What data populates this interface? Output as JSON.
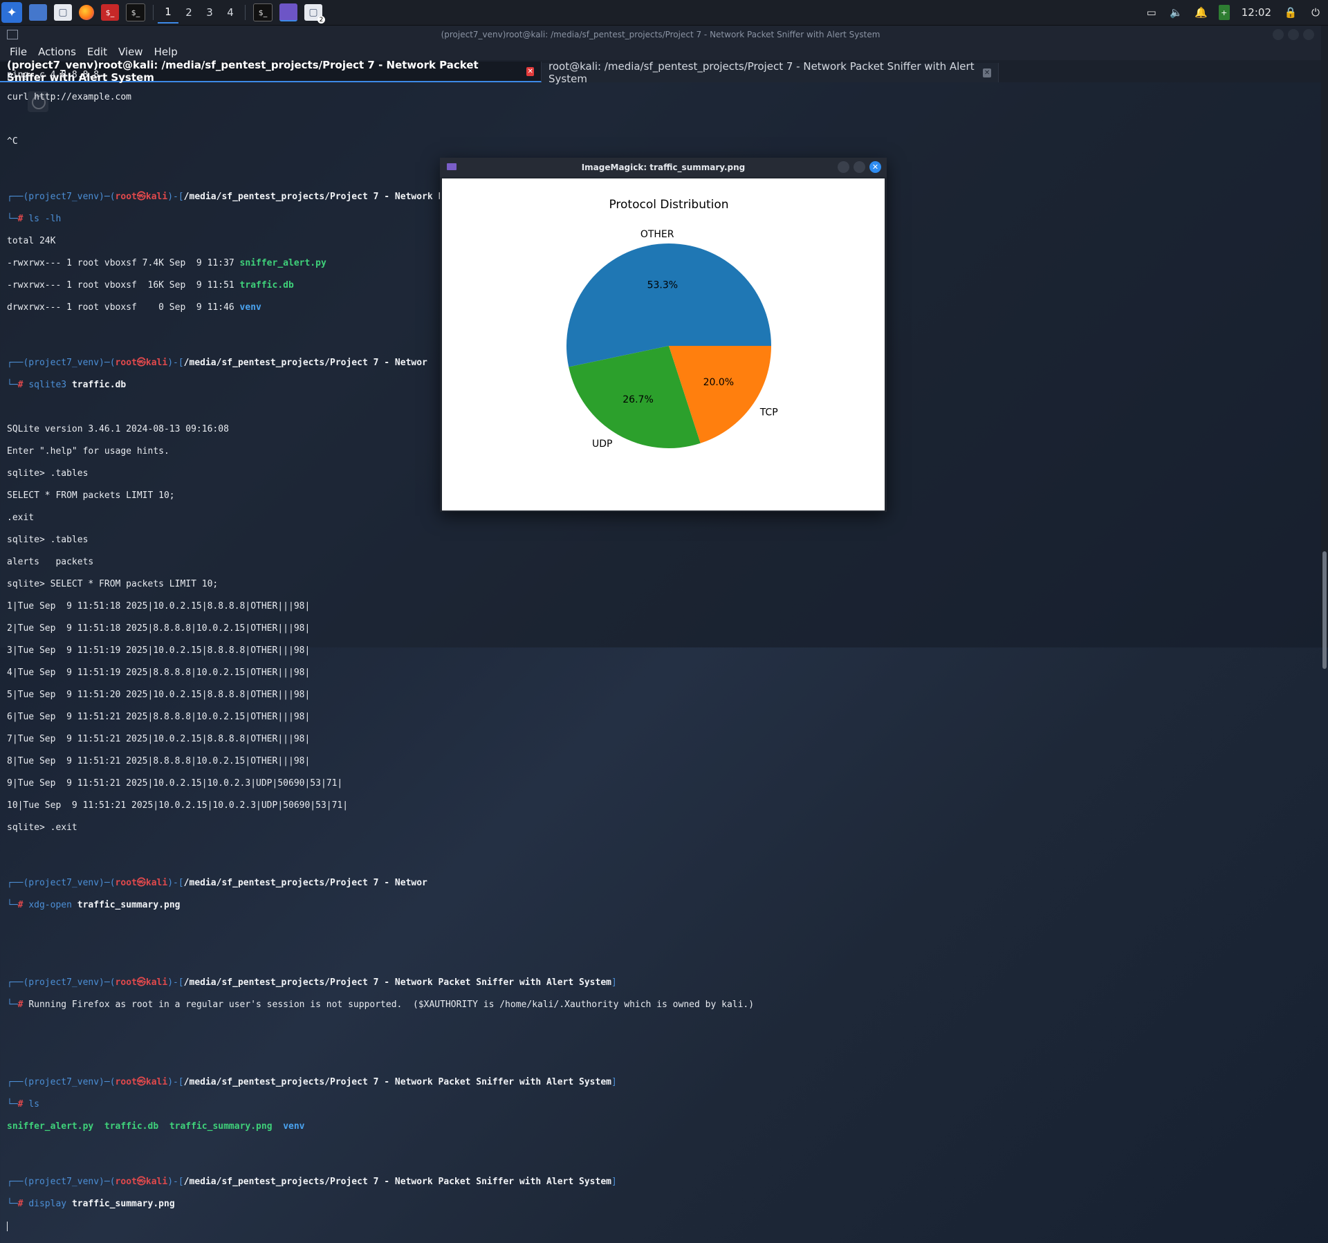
{
  "taskbar": {
    "workspaces": [
      "1",
      "2",
      "3",
      "4"
    ],
    "active_workspace": 0,
    "clock": "12:02",
    "notification_badge": "2"
  },
  "terminal": {
    "window_title": "(project7_venv)root@kali: /media/sf_pentest_projects/Project 7 - Network Packet Sniffer with Alert System",
    "menu": [
      "File",
      "Actions",
      "Edit",
      "View",
      "Help"
    ],
    "tabs": [
      {
        "label": "(project7_venv)root@kali: /media/sf_pentest_projects/Project 7 - Network Packet Sniffer with Alert System",
        "active": true
      },
      {
        "label": "root@kali: /media/sf_pentest_projects/Project 7 - Network Packet Sniffer with Alert System",
        "active": false
      }
    ],
    "prompt": {
      "venv": "(project7_venv)",
      "user": "root",
      "at": "㉿",
      "host": "kali",
      "path_full": "/media/sf_pentest_projects/Project 7 - Network Packet Sniffer with Alert System",
      "path_short": "/media/sf_pentest_projects/Project 7 - Networ"
    },
    "lines": {
      "l1": "ping -c 4 8.8.8.8",
      "l2": "curl http://example.com",
      "l3": "^C",
      "cmd_ls_lh": "ls -lh",
      "total": "total 24K",
      "f1_meta": "-rwxrwx--- 1 root vboxsf 7.4K Sep  9 11:37 ",
      "f1_name": "sniffer_alert.py",
      "f2_meta": "-rwxrwx--- 1 root vboxsf  16K Sep  9 11:51 ",
      "f2_name": "traffic.db",
      "f3_meta": "drwxrwx--- 1 root vboxsf    0 Sep  9 11:46 ",
      "f3_name": "venv",
      "cmd_sqlite": "sqlite3",
      "cmd_sqlite_arg": "traffic.db",
      "sql_version": "SQLite version 3.46.1 2024-08-13 09:16:08",
      "sql_help": "Enter \".help\" for usage hints.",
      "sql_tables1": "sqlite> .tables",
      "sql_select1": "SELECT * FROM packets LIMIT 10;",
      "sql_exit1": ".exit",
      "sql_tables2": "sqlite> .tables",
      "sql_tables_out": "alerts   packets",
      "sql_select2": "sqlite> SELECT * FROM packets LIMIT 10;",
      "rows": [
        "1|Tue Sep  9 11:51:18 2025|10.0.2.15|8.8.8.8|OTHER|||98|",
        "2|Tue Sep  9 11:51:18 2025|8.8.8.8|10.0.2.15|OTHER|||98|",
        "3|Tue Sep  9 11:51:19 2025|10.0.2.15|8.8.8.8|OTHER|||98|",
        "4|Tue Sep  9 11:51:19 2025|8.8.8.8|10.0.2.15|OTHER|||98|",
        "5|Tue Sep  9 11:51:20 2025|10.0.2.15|8.8.8.8|OTHER|||98|",
        "6|Tue Sep  9 11:51:21 2025|8.8.8.8|10.0.2.15|OTHER|||98|",
        "7|Tue Sep  9 11:51:21 2025|10.0.2.15|8.8.8.8|OTHER|||98|",
        "8|Tue Sep  9 11:51:21 2025|8.8.8.8|10.0.2.15|OTHER|||98|",
        "9|Tue Sep  9 11:51:21 2025|10.0.2.15|10.0.2.3|UDP|50690|53|71|",
        "10|Tue Sep  9 11:51:21 2025|10.0.2.15|10.0.2.3|UDP|50690|53|71|"
      ],
      "sql_exit2": "sqlite> .exit",
      "cmd_xdg": "xdg-open",
      "cmd_xdg_arg": "traffic_summary.png",
      "firefox_msg": "Running Firefox as root in a regular user's session is not supported.  ($XAUTHORITY is /home/kali/.Xauthority which is owned by kali.)",
      "cmd_ls": "ls",
      "ls_out": [
        "sniffer_alert.py",
        "traffic.db",
        "traffic_summary.png",
        "venv"
      ],
      "cmd_display": "display",
      "cmd_display_arg": "traffic_summary.png"
    }
  },
  "imagemagick": {
    "title": "ImageMagick: traffic_summary.png"
  },
  "chart_data": {
    "type": "pie",
    "title": "Protocol Distribution",
    "categories": [
      "OTHER",
      "UDP",
      "TCP"
    ],
    "values": [
      53.3,
      26.7,
      20.0
    ],
    "labels": [
      "53.3%",
      "26.7%",
      "20.0%"
    ],
    "colors": [
      "#1f77b4",
      "#2ca02c",
      "#ff7f0e"
    ],
    "start_angle_deg": 0,
    "direction": "counterclockwise"
  }
}
